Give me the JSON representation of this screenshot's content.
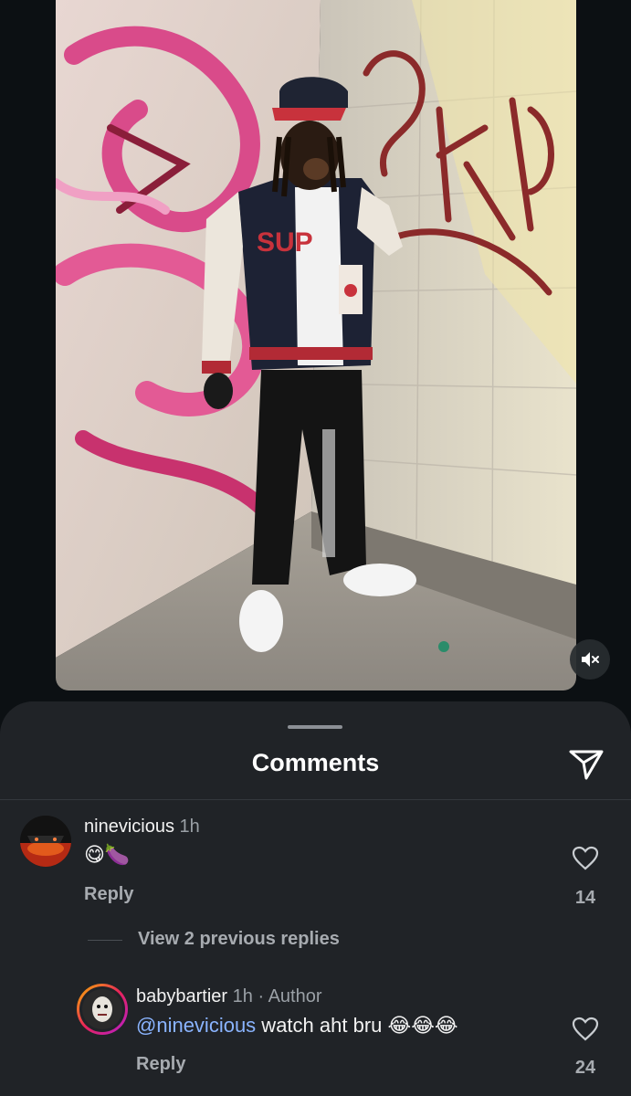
{
  "video": {
    "mute_icon": "speaker-muted-icon",
    "graffiti_left": "SUP"
  },
  "sheet": {
    "title": "Comments",
    "send_icon": "paper-plane-icon"
  },
  "comments": [
    {
      "username": "ninevicious",
      "time": "1h",
      "text": "😋🍆",
      "reply_label": "Reply",
      "likes": "14"
    }
  ],
  "view_replies": "View 2 previous replies",
  "replies": [
    {
      "username": "babybartier",
      "time": "1h",
      "separator": "·",
      "badge": "Author",
      "mention": "@ninevicious",
      "text": " watch aht bru 😂😂😂",
      "reply_label": "Reply",
      "likes": "24"
    }
  ]
}
